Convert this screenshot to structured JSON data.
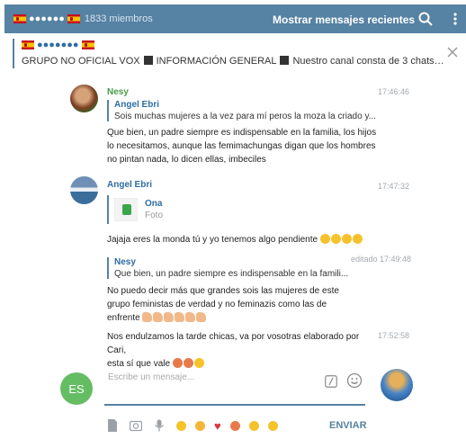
{
  "header": {
    "title_dots": "●●●●●●",
    "members": "1833 miembros",
    "recent_label": "Mostrar mensajes recientes"
  },
  "pinned": {
    "title_dots": "●●●●●●●",
    "segments": [
      "GRUPO NO OFICIAL VOX",
      "INFORMACIÓN GENERAL",
      "Nuestro canal consta de 3 chats: 1️⃣Chat GRUPO..."
    ]
  },
  "messages": [
    {
      "sender": "Nesy",
      "time": "17:46:46",
      "reply_name": "Angel Ebri",
      "reply_text": "Sois muchas mujeres a la vez para mí peros la moza la criado y...",
      "lines": [
        "Que bien, un padre siempre es indispensable en la familia, los hijos",
        "lo necesitamos, aunque las femimachungas digan que los hombres",
        "no pintan nada, lo dicen ellas, imbeciles"
      ]
    },
    {
      "sender": "Angel Ebri",
      "time": "17:47:32",
      "reply_name": "Ona",
      "reply_text": "Foto",
      "text": "Jajaja eres la monda tú y yo tenemos algo pendiente"
    },
    {
      "time": "editado 17:49:48",
      "reply_name": "Nesy",
      "reply_text": "Que bien, un padre siempre es indispensable en la famili...",
      "lines": [
        "No puedo decir más que grandes sois las mujeres de este",
        "grupo feministas de verdad y no feminazis como las de",
        "enfrente"
      ]
    },
    {
      "time": "17:52:58",
      "lines": [
        "Nos endulzamos la tarde chicas, va por vosotras elaborado por Cari,",
        "esta sí que vale"
      ]
    }
  ],
  "composer": {
    "initials": "ES",
    "placeholder": "Escribe un mensaje...",
    "send_label": "ENVIAR"
  },
  "colors": {
    "header_bg": "#5682a3",
    "accent": "#2e6ca3",
    "sender_green": "#4a9b45",
    "time_gray": "#a4aab0"
  }
}
